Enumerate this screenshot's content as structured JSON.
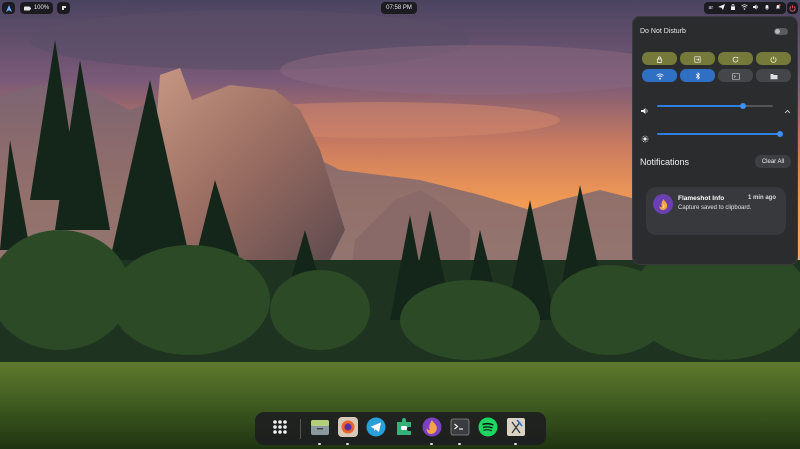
{
  "topbar": {
    "activities_icon": "arch-logo-icon",
    "battery_label": "100%",
    "clock": "07:58 PM",
    "keyboard_layout": "ar",
    "status_icons": [
      "keyboard-icon",
      "send-icon",
      "vpn-icon",
      "wifi-icon",
      "volume-icon",
      "notification-bell-icon",
      "bell-icon",
      "power-icon"
    ]
  },
  "quick_settings": {
    "dnd_label": "Do Not Disturb",
    "dnd_enabled": false,
    "buttons_row1": [
      "lock-icon",
      "logout-icon",
      "restart-icon",
      "power-icon"
    ],
    "buttons_row2": [
      "wifi-icon",
      "bluetooth-icon",
      "terminal-icon",
      "folder-icon"
    ],
    "volume_level": 0.73,
    "brightness_level": 1.0
  },
  "notifications": {
    "title": "Notifications",
    "clear_label": "Clear All",
    "items": [
      {
        "app": "Flameshot Info",
        "time": "1 min ago",
        "body": "Capture saved to clipboard."
      }
    ]
  },
  "dock": {
    "items": [
      "app-grid-icon",
      "files-icon",
      "firefox-icon",
      "telegram-icon",
      "extension-manager-icon",
      "flameshot-icon",
      "terminal-icon",
      "spotify-icon",
      "xournal-icon"
    ]
  },
  "colors": {
    "accent": "#2f6fc4",
    "olive": "#757a3a",
    "panel": "#2b2c2e"
  }
}
